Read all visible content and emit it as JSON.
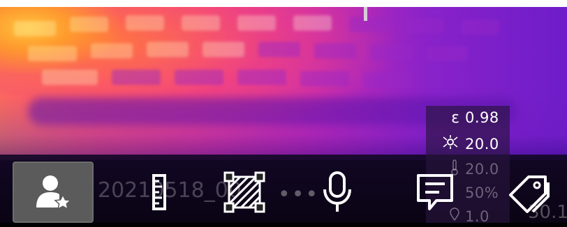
{
  "thermal_view": {
    "palette": "iron",
    "colors": {
      "hot": "#ffc23a",
      "mid": "#f0408c",
      "cool": "#6d1dc9"
    }
  },
  "parameters": [
    {
      "icon": "emissivity-icon",
      "symbol": "ε",
      "value": "0.98"
    },
    {
      "icon": "reflected-temperature-icon",
      "symbol": "☼",
      "value": "20.0"
    },
    {
      "icon": "atmospheric-temperature-icon",
      "symbol": "🌡",
      "value": "20.0"
    },
    {
      "icon": "humidity-icon",
      "symbol": "",
      "value": "50%"
    },
    {
      "icon": "distance-icon",
      "symbol": "",
      "value": "1.0"
    }
  ],
  "toolbar": {
    "filename": "20210518_00",
    "coordinate": "30.1",
    "buttons": [
      {
        "name": "profile-favorite-button",
        "icon": "user-star-icon",
        "selected": true
      },
      {
        "name": "measure-button",
        "icon": "ruler-icon",
        "selected": false
      },
      {
        "name": "area-button",
        "icon": "hatched-box-icon",
        "selected": false
      },
      {
        "name": "more-button",
        "icon": "ellipsis-icon",
        "selected": false
      },
      {
        "name": "voice-note-button",
        "icon": "microphone-icon",
        "selected": false
      },
      {
        "name": "text-note-button",
        "icon": "comment-icon",
        "selected": false
      },
      {
        "name": "tag-button",
        "icon": "tag-icon",
        "selected": false
      }
    ]
  }
}
